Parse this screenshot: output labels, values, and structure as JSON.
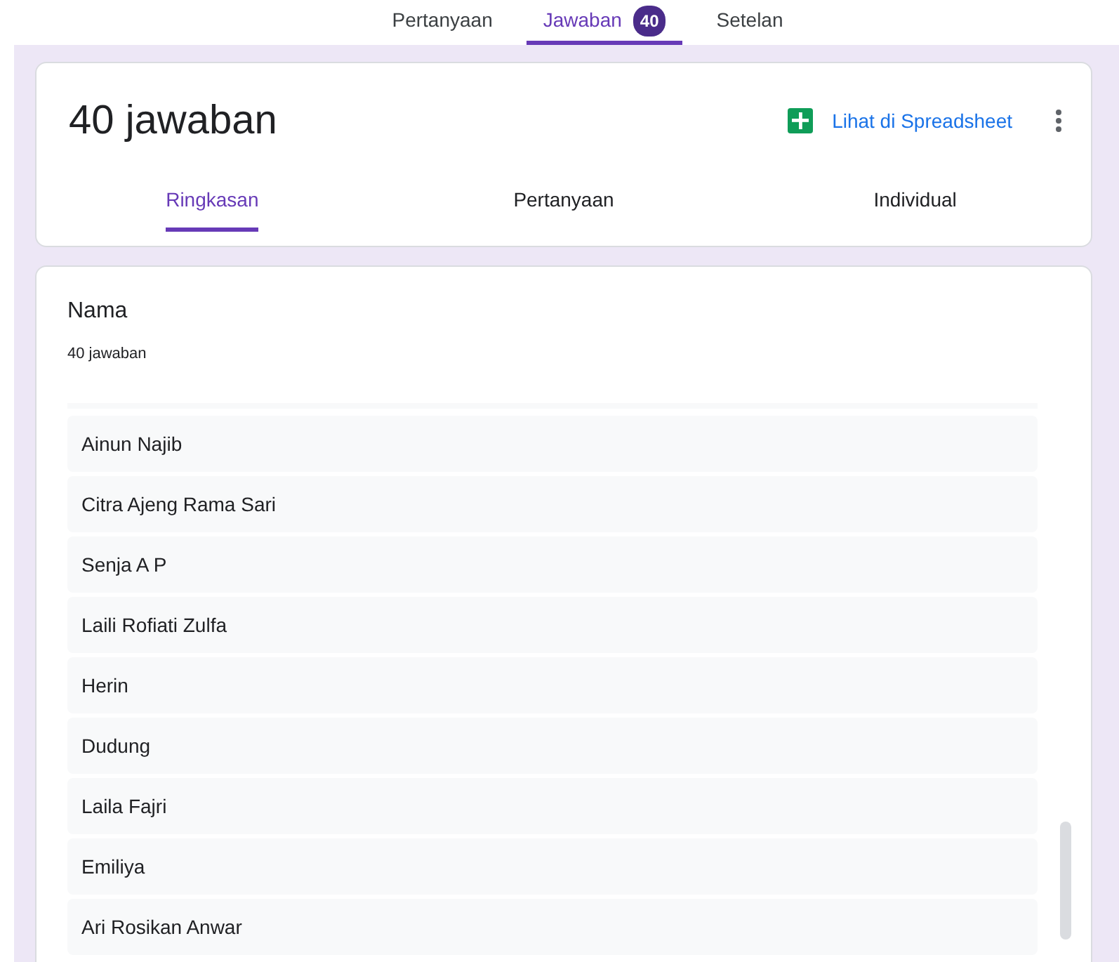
{
  "top_tabs": [
    {
      "label": "Pertanyaan",
      "selected": false
    },
    {
      "label": "Jawaban",
      "badge": "40",
      "selected": true
    },
    {
      "label": "Setelan",
      "selected": false
    }
  ],
  "header": {
    "title": "40 jawaban",
    "spreadsheet_link": "Lihat di Spreadsheet"
  },
  "sub_tabs": [
    {
      "label": "Ringkasan",
      "selected": true
    },
    {
      "label": "Pertanyaan",
      "selected": false
    },
    {
      "label": "Individual",
      "selected": false
    }
  ],
  "question": {
    "title": "Nama",
    "count": "40 jawaban",
    "answers": [
      "Ainun Najib",
      "Citra Ajeng Rama Sari",
      "Senja A P",
      "Laili Rofiati Zulfa",
      "Herin",
      "Dudung",
      "Laila Fajri",
      "Emiliya",
      "Ari Rosikan Anwar"
    ]
  }
}
